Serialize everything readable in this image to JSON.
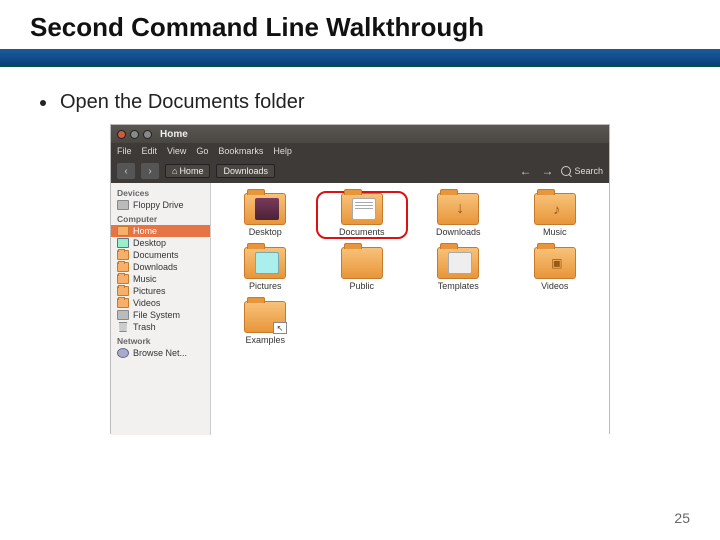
{
  "slide": {
    "title": "Second Command Line Walkthrough",
    "bullet": "Open the Documents folder",
    "page_number": "25"
  },
  "fm": {
    "window_title": "Home",
    "menubar": [
      "File",
      "Edit",
      "View",
      "Go",
      "Bookmarks",
      "Help"
    ],
    "breadcrumbs": [
      {
        "label": "Home",
        "icon": "house"
      },
      {
        "label": "Downloads",
        "icon": null
      }
    ],
    "search_label": "Search",
    "sidebar": {
      "sections": [
        {
          "title": "Devices",
          "items": [
            {
              "label": "Floppy Drive",
              "icon": "drive"
            }
          ]
        },
        {
          "title": "Computer",
          "items": [
            {
              "label": "Home",
              "icon": "house",
              "active": true
            },
            {
              "label": "Desktop",
              "icon": "monitor"
            },
            {
              "label": "Documents",
              "icon": "folder"
            },
            {
              "label": "Downloads",
              "icon": "folder"
            },
            {
              "label": "Music",
              "icon": "folder"
            },
            {
              "label": "Pictures",
              "icon": "folder"
            },
            {
              "label": "Videos",
              "icon": "folder"
            },
            {
              "label": "File System",
              "icon": "drive"
            },
            {
              "label": "Trash",
              "icon": "trash"
            }
          ]
        },
        {
          "title": "Network",
          "items": [
            {
              "label": "Browse Net...",
              "icon": "net"
            }
          ]
        }
      ]
    },
    "folders": [
      {
        "label": "Desktop",
        "emblem": "desktop",
        "highlight": false
      },
      {
        "label": "Documents",
        "emblem": "doc",
        "highlight": true
      },
      {
        "label": "Downloads",
        "emblem": "down",
        "highlight": false
      },
      {
        "label": "Music",
        "emblem": "music",
        "highlight": false
      },
      {
        "label": "Pictures",
        "emblem": "pic",
        "highlight": false
      },
      {
        "label": "Public",
        "emblem": "",
        "highlight": false
      },
      {
        "label": "Templates",
        "emblem": "tmpl",
        "highlight": false
      },
      {
        "label": "Videos",
        "emblem": "vid",
        "highlight": false
      },
      {
        "label": "Examples",
        "emblem": "ex",
        "highlight": false,
        "link": true
      }
    ]
  }
}
